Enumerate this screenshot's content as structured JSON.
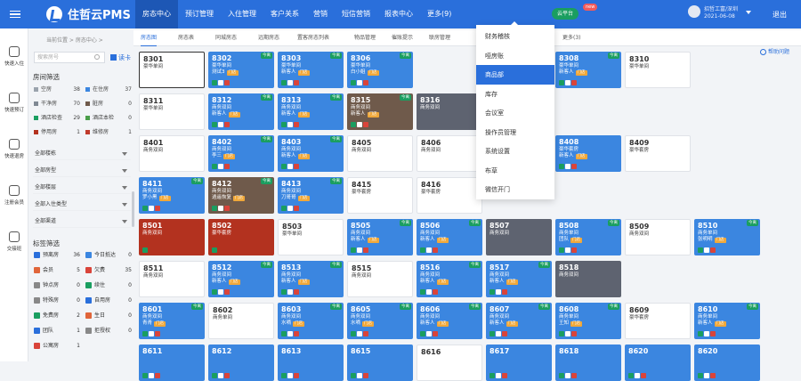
{
  "app": {
    "title": "住哲云PMS",
    "new_badge": "new",
    "cloud": "云平台",
    "user_name": "招哲工富/深圳",
    "user_date": "2021-06-08",
    "logout": "退出"
  },
  "nav": [
    "房态中心",
    "预订管理",
    "入住管理",
    "客户关系",
    "营销",
    "短信营销",
    "报表中心",
    "更多(9)"
  ],
  "side": [
    "快速入住",
    "快速预订",
    "快速退房",
    "注册会员",
    "交接班"
  ],
  "breadcrumb": "当前位置 > 房态中心 >",
  "filter": {
    "placeholder": "搜索房号",
    "reload": "读卡",
    "status_title": "房间筛选",
    "tag_title": "标签筛选",
    "status": [
      {
        "label": "空房",
        "n": "38",
        "c": "#9aa3ad"
      },
      {
        "label": "在住房",
        "n": "37",
        "c": "#3b86e0"
      },
      {
        "label": "干净房",
        "n": "70",
        "c": "#7f8893"
      },
      {
        "label": "脏房",
        "n": "0",
        "c": "#6f5a4b"
      },
      {
        "label": "酒店检查",
        "n": "29",
        "c": "#1a9e60"
      },
      {
        "label": "酒店本检",
        "n": "0",
        "c": "#4a9e4a"
      },
      {
        "label": "停用房",
        "n": "1",
        "c": "#b3321f"
      },
      {
        "label": "维修房",
        "n": "1",
        "c": "#c03a2b"
      }
    ],
    "dropdowns": [
      "全部楼栋",
      "全部房型",
      "全部楼层",
      "全部入住类型",
      "全部渠道"
    ],
    "tags": [
      {
        "label": "预离房",
        "n": "36",
        "c": "#2a6fdb"
      },
      {
        "label": "今日抵达",
        "n": "0",
        "c": "#3b86e0"
      },
      {
        "label": "会员",
        "n": "5",
        "c": "#e0653a"
      },
      {
        "label": "欠费",
        "n": "35",
        "c": "#d9443a"
      },
      {
        "label": "钟点房",
        "n": "0",
        "c": "#888"
      },
      {
        "label": "续住",
        "n": "0",
        "c": "#1a9e60"
      },
      {
        "label": "特殊房",
        "n": "0",
        "c": "#888"
      },
      {
        "label": "自用房",
        "n": "0",
        "c": "#2a6fdb"
      },
      {
        "label": "免费房",
        "n": "2",
        "c": "#1a9e60"
      },
      {
        "label": "生日",
        "n": "0",
        "c": "#e0653a"
      },
      {
        "label": "团队",
        "n": "1",
        "c": "#2a6fdb"
      },
      {
        "label": "拒授权",
        "n": "0",
        "c": "#888"
      },
      {
        "label": "公寓房",
        "n": "1",
        "c": "#d9443a"
      }
    ]
  },
  "tabs": [
    "房态图",
    "房态表",
    "同城房态",
    "远期房态",
    "置客房态列表",
    "物品管理",
    "催账提示",
    "联房管理",
    "更多(3)"
  ],
  "help": "帮助问题",
  "menu": [
    "财务稽核",
    "哑房账",
    "商品部",
    "库存",
    "会议室",
    "操作员管理",
    "系统设置",
    "布草",
    "微信开门"
  ],
  "rooms": [
    [
      "8301",
      "豪华单间",
      "",
      "",
      "sel",
      0
    ],
    [
      "8302",
      "豪华单间",
      "测试3",
      "门店",
      "blue",
      1
    ],
    [
      "8303",
      "豪华单间",
      "新客人",
      "门店",
      "blue",
      1
    ],
    [
      "8306",
      "豪华单间",
      "白小姐",
      "门店",
      "blue",
      1
    ],
    [
      "",
      "",
      "",
      "",
      "",
      0
    ],
    [
      "",
      "",
      "",
      "",
      "",
      0
    ],
    [
      "8308",
      "豪华单间",
      "新客人",
      "门店",
      "blue",
      1
    ],
    [
      "8310",
      "豪华单间",
      "",
      "",
      "white",
      0
    ],
    [
      "8311",
      "豪华单间",
      "",
      "",
      "white",
      0
    ],
    [
      "8312",
      "商务双间",
      "新客人",
      "门店",
      "blue",
      1
    ],
    [
      "8313",
      "商务双间",
      "新客人",
      "门店",
      "blue",
      1
    ],
    [
      "8315",
      "商务双间",
      "新客人",
      "门店",
      "brown",
      1
    ],
    [
      "8316",
      "商务双间",
      "",
      "",
      "dark",
      0
    ],
    [
      "",
      "",
      "",
      "",
      "",
      0
    ],
    [
      "",
      "",
      "",
      "",
      "",
      0
    ],
    [
      "",
      "",
      "",
      "",
      "",
      0
    ],
    [
      "8401",
      "商务双间",
      "",
      "",
      "white",
      0
    ],
    [
      "8402",
      "商务双间",
      "李三",
      "门店",
      "blue",
      1
    ],
    [
      "8403",
      "商务双间",
      "新客人",
      "门店",
      "blue",
      1
    ],
    [
      "8405",
      "商务双间",
      "",
      "",
      "white",
      0
    ],
    [
      "8406",
      "商务双间",
      "",
      "",
      "white",
      0
    ],
    [
      "",
      "",
      "",
      "",
      "",
      0
    ],
    [
      "8408",
      "豪华套房",
      "新客人",
      "门店",
      "blue",
      0
    ],
    [
      "8409",
      "豪华套房",
      "",
      "",
      "white",
      0
    ],
    [
      "8411",
      "商务双间",
      "罗小黑",
      "门店",
      "blue",
      1
    ],
    [
      "8412",
      "商务双间",
      "逍遥恢复",
      "门店",
      "brown",
      1
    ],
    [
      "8413",
      "商务双间",
      "刀哥哥",
      "门店",
      "blue",
      1
    ],
    [
      "8415",
      "豪华套房",
      "",
      "",
      "white",
      0
    ],
    [
      "8416",
      "豪华套房",
      "",
      "",
      "white",
      0
    ],
    [
      "",
      "",
      "",
      "",
      "",
      0
    ],
    [
      "",
      "",
      "",
      "",
      "",
      0
    ],
    [
      "",
      "",
      "",
      "",
      "",
      0
    ],
    [
      "8501",
      "商务双间",
      "",
      "",
      "red",
      0
    ],
    [
      "8502",
      "豪华套房",
      "",
      "",
      "red",
      0
    ],
    [
      "8503",
      "豪华单间",
      "",
      "",
      "white",
      0
    ],
    [
      "8505",
      "商务双间",
      "新客人",
      "门店",
      "blue",
      1
    ],
    [
      "8506",
      "商务双间",
      "新客人",
      "门店",
      "blue",
      1
    ],
    [
      "8507",
      "商务双间",
      "",
      "",
      "dark",
      0
    ],
    [
      "8508",
      "商务单间",
      "团队",
      "门店",
      "blue",
      1
    ],
    [
      "8509",
      "商务双间",
      "",
      "",
      "white",
      0
    ],
    [
      "8511",
      "商务双间",
      "",
      "",
      "white",
      0
    ],
    [
      "8512",
      "商务双间",
      "新客人",
      "门店",
      "blue",
      1
    ],
    [
      "8513",
      "商务双间",
      "新客人",
      "门店",
      "blue",
      1
    ],
    [
      "8515",
      "商务双间",
      "",
      "",
      "white",
      0
    ],
    [
      "8516",
      "商务双间",
      "新客人",
      "门店",
      "blue",
      1
    ],
    [
      "8517",
      "商务双间",
      "新客人",
      "门店",
      "blue",
      1
    ],
    [
      "8518",
      "商务双间",
      "",
      "",
      "dark",
      0
    ],
    [
      "",
      "",
      "",
      "",
      "",
      0
    ],
    [
      "8601",
      "商务双间",
      "青青",
      "门店",
      "blue",
      1
    ],
    [
      "8602",
      "商务单间",
      "",
      "",
      "white",
      0
    ],
    [
      "8603",
      "商务双间",
      "水嘀",
      "门店",
      "blue",
      1
    ],
    [
      "8605",
      "商务双间",
      "水嘀",
      "门店",
      "blue",
      1
    ],
    [
      "8606",
      "商务双间",
      "新客人",
      "门店",
      "blue",
      1
    ],
    [
      "8607",
      "商务双间",
      "新客人",
      "门店",
      "blue",
      1
    ],
    [
      "8608",
      "商务单间",
      "王知",
      "门店",
      "blue",
      1
    ],
    [
      "8609",
      "豪华套房",
      "",
      "",
      "white",
      0
    ],
    [
      "8611",
      "",
      "",
      "",
      "blue",
      0
    ],
    [
      "8612",
      "",
      "",
      "",
      "blue",
      0
    ],
    [
      "8613",
      "",
      "",
      "",
      "blue",
      0
    ],
    [
      "8615",
      "",
      "",
      "",
      "blue",
      0
    ],
    [
      "8616",
      "",
      "",
      "",
      "white",
      0
    ],
    [
      "8617",
      "",
      "",
      "",
      "blue",
      0
    ],
    [
      "8618",
      "",
      "",
      "",
      "blue",
      0
    ],
    [
      "8620",
      "",
      "",
      "",
      "blue",
      0
    ]
  ],
  "extra_col": [
    [
      "8310",
      "豪华单间",
      "",
      "",
      "white",
      0
    ],
    [
      "",
      "",
      "",
      "",
      "",
      0
    ],
    [
      "8410",
      "商务双间",
      "",
      "",
      "white",
      0
    ],
    [
      "",
      "",
      "",
      "",
      "",
      0
    ],
    [
      "8510",
      "商务单间",
      "张明明",
      "门店",
      "blue",
      1
    ],
    [
      "",
      "",
      "",
      "",
      "",
      0
    ],
    [
      "8610",
      "商务单间",
      "新客人",
      "门店",
      "blue",
      1
    ],
    [
      "8620",
      "",
      "",
      "",
      "blue",
      0
    ]
  ],
  "badge_text": "今离"
}
